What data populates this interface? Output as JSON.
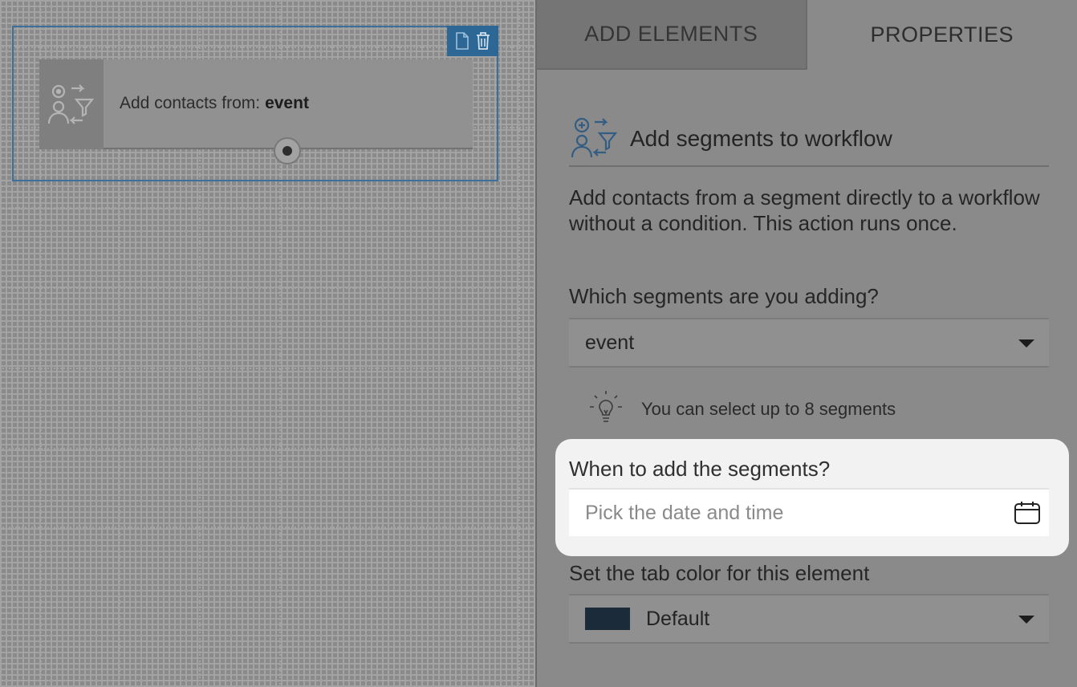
{
  "canvas": {
    "node": {
      "label_prefix": "Add contacts from:",
      "label_value": "event",
      "toolbar": {
        "copy_icon": "document-icon",
        "delete_icon": "trash-icon"
      },
      "icon": "add-segment-icon"
    }
  },
  "panel": {
    "tabs": [
      {
        "label": "ADD ELEMENTS",
        "active": false
      },
      {
        "label": "PROPERTIES",
        "active": true
      }
    ],
    "section_title": "Add segments to workflow",
    "description": "Add contacts from a segment directly to a workflow without a condition. This action runs once.",
    "segments_label": "Which segments are you adding?",
    "segments_value": "event",
    "tip_text": "You can select up to 8 segments",
    "when_label": "When to add the segments?",
    "when_placeholder": "Pick the date and time",
    "color_label": "Set the tab color for this element",
    "color_value": "Default",
    "color_swatch": "#1b2b3a"
  }
}
